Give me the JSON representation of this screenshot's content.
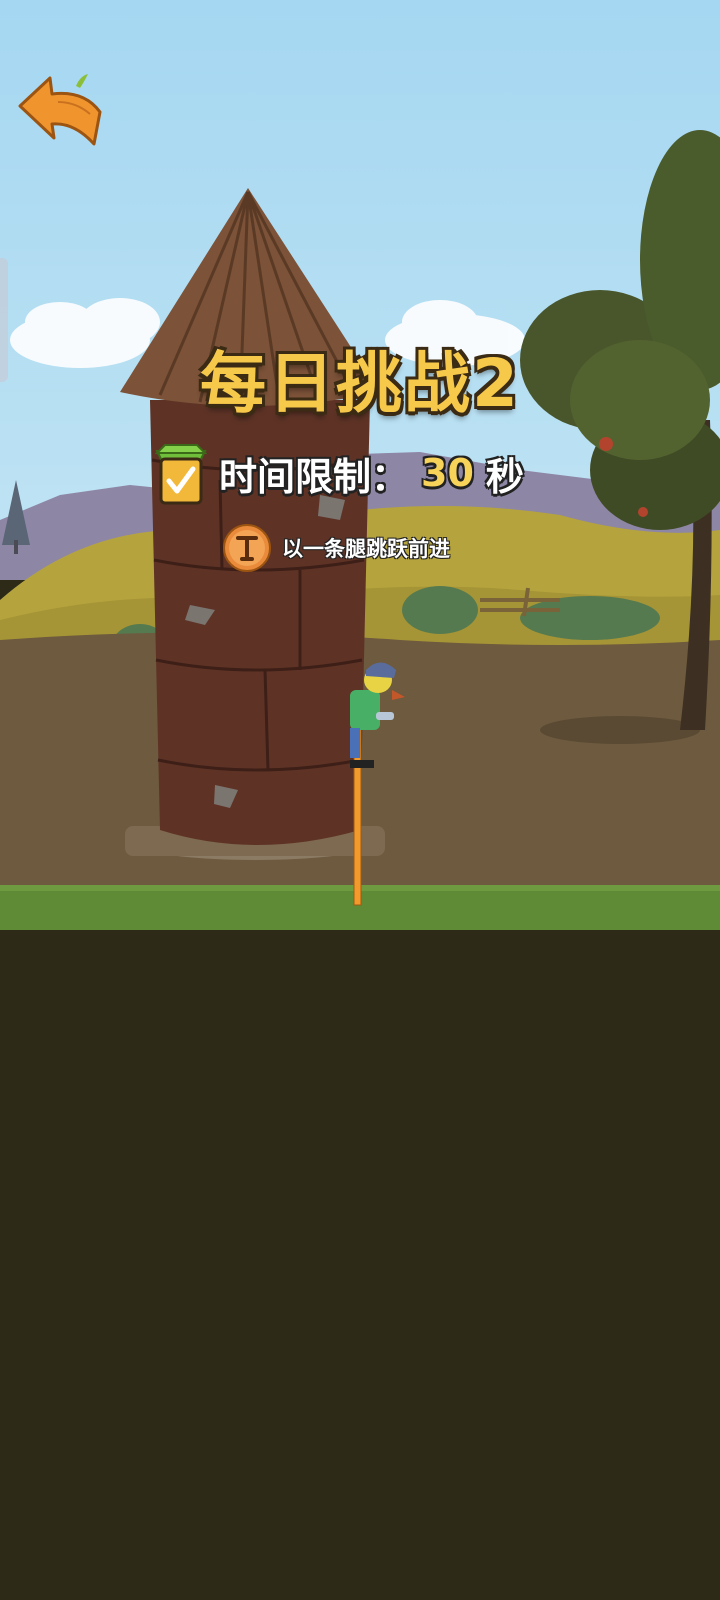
{
  "challenge": {
    "title": "每日挑战2",
    "time_limit_label": "时间限制：",
    "time_limit_value": "30",
    "time_limit_unit": "秒",
    "rule_text": "以一条腿跳跃前进"
  },
  "icons": {
    "back": "back-arrow-sign-icon",
    "notepad": "checklist-notepad-icon",
    "rule": "pogo-stick-coin-icon"
  },
  "colors": {
    "sky": "#a6d8f1",
    "title_gold": "#f7c94a",
    "grass": "#5f8a36",
    "ground_dark": "#2d2a18",
    "tower": "#5e3326",
    "pole": "#f39a2d"
  }
}
